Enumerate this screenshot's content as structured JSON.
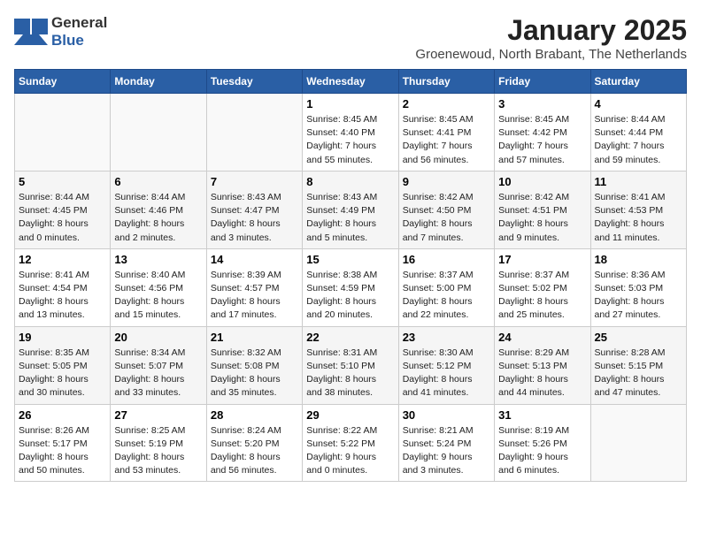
{
  "header": {
    "logo_general": "General",
    "logo_blue": "Blue",
    "month": "January 2025",
    "location": "Groenewoud, North Brabant, The Netherlands"
  },
  "weekdays": [
    "Sunday",
    "Monday",
    "Tuesday",
    "Wednesday",
    "Thursday",
    "Friday",
    "Saturday"
  ],
  "weeks": [
    [
      {
        "day": "",
        "info": ""
      },
      {
        "day": "",
        "info": ""
      },
      {
        "day": "",
        "info": ""
      },
      {
        "day": "1",
        "info": "Sunrise: 8:45 AM\nSunset: 4:40 PM\nDaylight: 7 hours\nand 55 minutes."
      },
      {
        "day": "2",
        "info": "Sunrise: 8:45 AM\nSunset: 4:41 PM\nDaylight: 7 hours\nand 56 minutes."
      },
      {
        "day": "3",
        "info": "Sunrise: 8:45 AM\nSunset: 4:42 PM\nDaylight: 7 hours\nand 57 minutes."
      },
      {
        "day": "4",
        "info": "Sunrise: 8:44 AM\nSunset: 4:44 PM\nDaylight: 7 hours\nand 59 minutes."
      }
    ],
    [
      {
        "day": "5",
        "info": "Sunrise: 8:44 AM\nSunset: 4:45 PM\nDaylight: 8 hours\nand 0 minutes."
      },
      {
        "day": "6",
        "info": "Sunrise: 8:44 AM\nSunset: 4:46 PM\nDaylight: 8 hours\nand 2 minutes."
      },
      {
        "day": "7",
        "info": "Sunrise: 8:43 AM\nSunset: 4:47 PM\nDaylight: 8 hours\nand 3 minutes."
      },
      {
        "day": "8",
        "info": "Sunrise: 8:43 AM\nSunset: 4:49 PM\nDaylight: 8 hours\nand 5 minutes."
      },
      {
        "day": "9",
        "info": "Sunrise: 8:42 AM\nSunset: 4:50 PM\nDaylight: 8 hours\nand 7 minutes."
      },
      {
        "day": "10",
        "info": "Sunrise: 8:42 AM\nSunset: 4:51 PM\nDaylight: 8 hours\nand 9 minutes."
      },
      {
        "day": "11",
        "info": "Sunrise: 8:41 AM\nSunset: 4:53 PM\nDaylight: 8 hours\nand 11 minutes."
      }
    ],
    [
      {
        "day": "12",
        "info": "Sunrise: 8:41 AM\nSunset: 4:54 PM\nDaylight: 8 hours\nand 13 minutes."
      },
      {
        "day": "13",
        "info": "Sunrise: 8:40 AM\nSunset: 4:56 PM\nDaylight: 8 hours\nand 15 minutes."
      },
      {
        "day": "14",
        "info": "Sunrise: 8:39 AM\nSunset: 4:57 PM\nDaylight: 8 hours\nand 17 minutes."
      },
      {
        "day": "15",
        "info": "Sunrise: 8:38 AM\nSunset: 4:59 PM\nDaylight: 8 hours\nand 20 minutes."
      },
      {
        "day": "16",
        "info": "Sunrise: 8:37 AM\nSunset: 5:00 PM\nDaylight: 8 hours\nand 22 minutes."
      },
      {
        "day": "17",
        "info": "Sunrise: 8:37 AM\nSunset: 5:02 PM\nDaylight: 8 hours\nand 25 minutes."
      },
      {
        "day": "18",
        "info": "Sunrise: 8:36 AM\nSunset: 5:03 PM\nDaylight: 8 hours\nand 27 minutes."
      }
    ],
    [
      {
        "day": "19",
        "info": "Sunrise: 8:35 AM\nSunset: 5:05 PM\nDaylight: 8 hours\nand 30 minutes."
      },
      {
        "day": "20",
        "info": "Sunrise: 8:34 AM\nSunset: 5:07 PM\nDaylight: 8 hours\nand 33 minutes."
      },
      {
        "day": "21",
        "info": "Sunrise: 8:32 AM\nSunset: 5:08 PM\nDaylight: 8 hours\nand 35 minutes."
      },
      {
        "day": "22",
        "info": "Sunrise: 8:31 AM\nSunset: 5:10 PM\nDaylight: 8 hours\nand 38 minutes."
      },
      {
        "day": "23",
        "info": "Sunrise: 8:30 AM\nSunset: 5:12 PM\nDaylight: 8 hours\nand 41 minutes."
      },
      {
        "day": "24",
        "info": "Sunrise: 8:29 AM\nSunset: 5:13 PM\nDaylight: 8 hours\nand 44 minutes."
      },
      {
        "day": "25",
        "info": "Sunrise: 8:28 AM\nSunset: 5:15 PM\nDaylight: 8 hours\nand 47 minutes."
      }
    ],
    [
      {
        "day": "26",
        "info": "Sunrise: 8:26 AM\nSunset: 5:17 PM\nDaylight: 8 hours\nand 50 minutes."
      },
      {
        "day": "27",
        "info": "Sunrise: 8:25 AM\nSunset: 5:19 PM\nDaylight: 8 hours\nand 53 minutes."
      },
      {
        "day": "28",
        "info": "Sunrise: 8:24 AM\nSunset: 5:20 PM\nDaylight: 8 hours\nand 56 minutes."
      },
      {
        "day": "29",
        "info": "Sunrise: 8:22 AM\nSunset: 5:22 PM\nDaylight: 9 hours\nand 0 minutes."
      },
      {
        "day": "30",
        "info": "Sunrise: 8:21 AM\nSunset: 5:24 PM\nDaylight: 9 hours\nand 3 minutes."
      },
      {
        "day": "31",
        "info": "Sunrise: 8:19 AM\nSunset: 5:26 PM\nDaylight: 9 hours\nand 6 minutes."
      },
      {
        "day": "",
        "info": ""
      }
    ]
  ]
}
